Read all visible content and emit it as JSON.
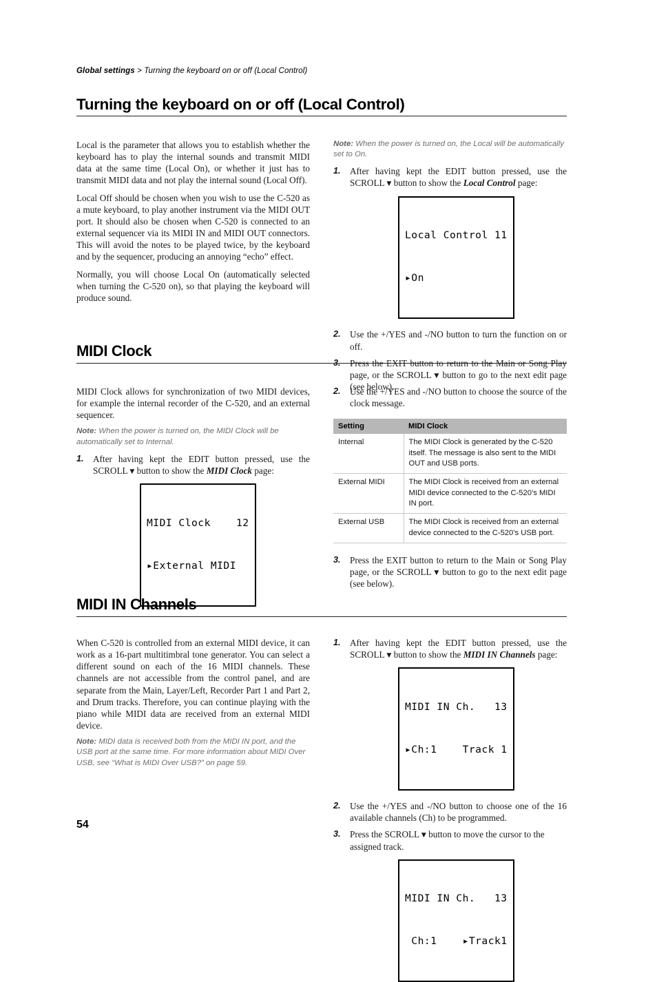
{
  "breadcrumb": {
    "section": "Global settings",
    "separator": " > ",
    "current": "Turning the keyboard on or off (Local Control)"
  },
  "page_number": "54",
  "sections": [
    {
      "id": "local-control",
      "heading": "Turning the keyboard on or off (Local Control)",
      "left": {
        "paragraphs": [
          "Local is the parameter that allows you to establish whether the keyboard has to play the internal sounds and transmit MIDI data at the same time (Local On), or whether it just has to transmit MIDI data and not play the internal sound (Local Off).",
          "Local Off should be chosen when you wish to use the C-520 as a mute keyboard, to play another instrument via the MIDI OUT port. It should also be chosen when C-520 is connected to an external sequencer via its MIDI IN and MIDI OUT connectors. This will avoid the notes to be played twice, by the keyboard and by the sequencer, producing an annoying “echo” effect.",
          "Normally, you will choose Local On (automatically selected when turning the C-520 on), so that playing the keyboard will produce sound."
        ]
      },
      "right": {
        "note_label": "Note:",
        "note_text": " When the power is turned on, the Local will be automatically set to On.",
        "steps": [
          {
            "num": "1.",
            "parts": [
              {
                "t": "After having kept the EDIT button pressed, use the SCROLL "
              },
              {
                "t": "▼",
                "style": "arrow"
              },
              {
                "t": " button to show the "
              },
              {
                "t": "Local Control",
                "style": "bold-italic"
              },
              {
                "t": " page:"
              }
            ]
          },
          {
            "num": "2.",
            "parts": [
              {
                "t": "Use the +/YES and -/NO button to turn the function on or off."
              }
            ]
          },
          {
            "num": "3.",
            "parts": [
              {
                "t": "Press the EXIT button to return to the Main or Song Play page, or the SCROLL "
              },
              {
                "t": "▼",
                "style": "arrow"
              },
              {
                "t": " button to go to the next edit page (see below)."
              }
            ]
          }
        ],
        "lcd": {
          "line1": "Local Control 11",
          "line2": "▸On"
        }
      }
    },
    {
      "id": "midi-clock",
      "heading": "MIDI Clock",
      "left": {
        "paragraphs": [
          "MIDI Clock allows for synchronization of two MIDI devices, for example the internal recorder of the C-520, and an external sequencer."
        ],
        "note_label": "Note:",
        "note_text": " When the power is turned on, the MIDI Clock will be automatically set to Internal.",
        "steps": [
          {
            "num": "1.",
            "parts": [
              {
                "t": "After having kept the EDIT button pressed, use the SCROLL "
              },
              {
                "t": "▼",
                "style": "arrow"
              },
              {
                "t": " button to show the "
              },
              {
                "t": "MIDI Clock",
                "style": "bold-italic"
              },
              {
                "t": " page:"
              }
            ]
          }
        ],
        "lcd": {
          "line1": "MIDI Clock    12",
          "line2": "▸External MIDI"
        }
      },
      "right": {
        "steps_before": [
          {
            "num": "2.",
            "parts": [
              {
                "t": "Use the +/YES and -/NO button to choose the source of the clock message."
              }
            ]
          }
        ],
        "table": {
          "headers": [
            "Setting",
            "MIDI Clock"
          ],
          "rows": [
            [
              "Internal",
              "The MIDI Clock is generated by the C-520 itself. The message is also sent to the MIDI OUT and USB ports."
            ],
            [
              "External MIDI",
              "The MIDI Clock is received from an external MIDI device connected to the C-520’s MIDI IN port."
            ],
            [
              "External USB",
              "The MIDI Clock is received from an external device connected to the C-520’s USB port."
            ]
          ]
        },
        "steps_after": [
          {
            "num": "3.",
            "parts": [
              {
                "t": "Press the EXIT button to return to the Main or Song Play page, or the SCROLL "
              },
              {
                "t": "▼",
                "style": "arrow"
              },
              {
                "t": " button to go to the next edit page (see below)."
              }
            ]
          }
        ]
      }
    },
    {
      "id": "midi-in-channels",
      "heading": "MIDI IN Channels",
      "left": {
        "paragraphs": [
          "When C-520 is controlled from an external MIDI device, it can work as a 16-part multitimbral tone generator. You can select a different sound on each of the 16 MIDI channels. These channels are not accessible from the control panel, and are separate from the Main, Layer/Left, Recorder Part 1 and Part 2, and Drum tracks. Therefore, you can continue playing with the piano while MIDI data are received from an external MIDI device."
        ],
        "note_label": "Note:",
        "note_text": " MIDI data is received both from the MIDI IN port, and the USB port at the same time. For more information about MIDI Over USB, see “What is MIDI Over USB?” on page 59."
      },
      "right": {
        "steps": [
          {
            "num": "1.",
            "parts": [
              {
                "t": "After having kept the EDIT button pressed, use the SCROLL "
              },
              {
                "t": "▼",
                "style": "arrow"
              },
              {
                "t": " button to show the "
              },
              {
                "t": "MIDI IN Channels",
                "style": "bold-italic"
              },
              {
                "t": " page:"
              }
            ]
          },
          {
            "num": "2.",
            "parts": [
              {
                "t": "Use the +/YES and -/NO button to choose one of the 16 available channels (Ch) to be programmed."
              }
            ]
          },
          {
            "num": "3.",
            "parts": [
              {
                "t": "Press the SCROLL "
              },
              {
                "t": "▼",
                "style": "arrow"
              },
              {
                "t": " button to move the cursor to the assigned track."
              }
            ]
          }
        ],
        "lcd1": {
          "line1": "MIDI IN Ch.   13",
          "line2": "▸Ch:1    Track 1"
        },
        "lcd2": {
          "line1": "MIDI IN Ch.   13",
          "line2": " Ch:1    ▸Track1"
        }
      }
    }
  ],
  "colors": {
    "note_text": "#6e6e6e",
    "table_header_bg": "#b7b7b7",
    "table_divider": "#c9c9c9",
    "rule": "#222222"
  }
}
